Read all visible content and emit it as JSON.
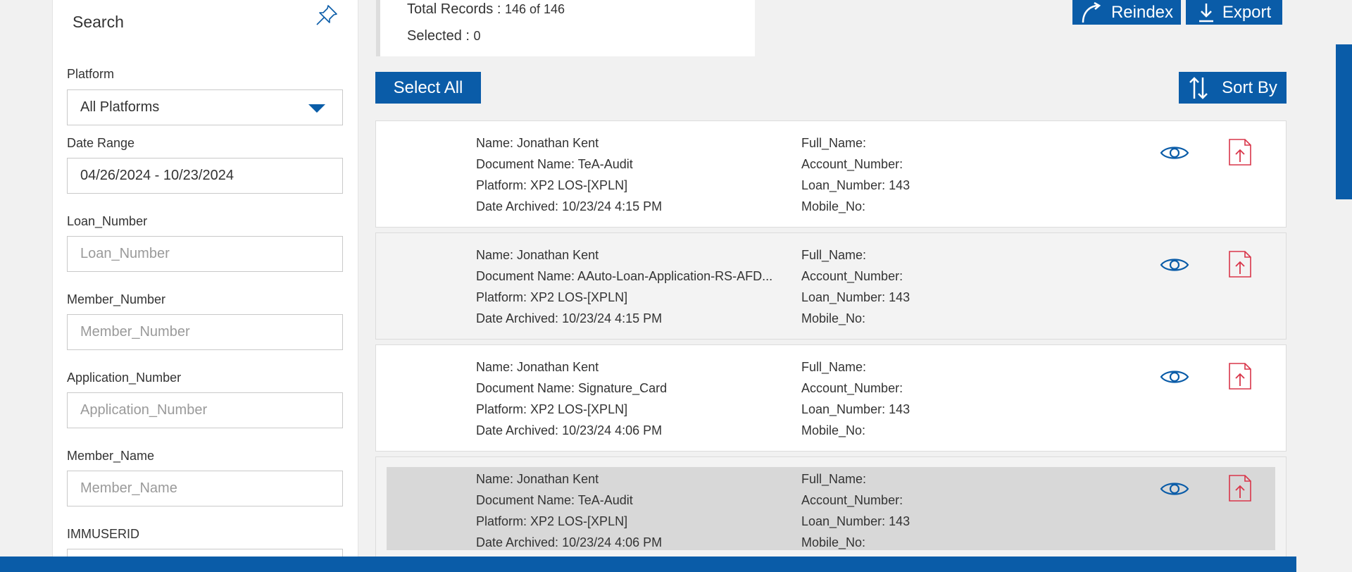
{
  "search": {
    "title": "Search",
    "fields": [
      {
        "label": "Platform",
        "value": "All Platforms",
        "type": "select"
      },
      {
        "label": "Date Range",
        "value": "04/26/2024 - 10/23/2024",
        "type": "text"
      },
      {
        "label": "Loan_Number",
        "placeholder": "Loan_Number",
        "type": "text"
      },
      {
        "label": "Member_Number",
        "placeholder": "Member_Number",
        "type": "text"
      },
      {
        "label": "Application_Number",
        "placeholder": "Application_Number",
        "type": "text"
      },
      {
        "label": "Member_Name",
        "placeholder": "Member_Name",
        "type": "text"
      },
      {
        "label": "IMMUSERID",
        "placeholder": "",
        "type": "text"
      }
    ]
  },
  "records": {
    "total_label": "Total Records :",
    "total_value": "146 of 146",
    "selected_label": "Selected :",
    "selected_value": "0"
  },
  "toolbar": {
    "reindex_label": "Reindex",
    "export_label": "Export",
    "select_all_label": "Select All",
    "sort_by_label": "Sort By"
  },
  "cards": [
    {
      "name": "Name: Jonathan Kent",
      "document": "Document Name: TeA-Audit",
      "platform": "Platform: XP2 LOS-[XPLN]",
      "archived": "Date Archived: 10/23/24 4:15 PM",
      "full_name": "Full_Name:",
      "account": "Account_Number:",
      "loan": "Loan_Number: 143",
      "mobile": "Mobile_No:"
    },
    {
      "name": "Name: Jonathan Kent",
      "document": "Document Name: AAuto-Loan-Application-RS-AFD...",
      "platform": "Platform: XP2 LOS-[XPLN]",
      "archived": "Date Archived: 10/23/24 4:15 PM",
      "full_name": "Full_Name:",
      "account": "Account_Number:",
      "loan": "Loan_Number: 143",
      "mobile": "Mobile_No:"
    },
    {
      "name": "Name: Jonathan Kent",
      "document": "Document Name: Signature_Card",
      "platform": "Platform: XP2 LOS-[XPLN]",
      "archived": "Date Archived: 10/23/24 4:06 PM",
      "full_name": "Full_Name:",
      "account": "Account_Number:",
      "loan": "Loan_Number: 143",
      "mobile": "Mobile_No:"
    },
    {
      "name": "Name: Jonathan Kent",
      "document": "Document Name: TeA-Audit",
      "platform": "Platform: XP2 LOS-[XPLN]",
      "archived": "Date Archived: 10/23/24 4:06 PM",
      "full_name": "Full_Name:",
      "account": "Account_Number:",
      "loan": "Loan_Number: 143",
      "mobile": "Mobile_No:"
    }
  ],
  "icons": {
    "view": "eye-icon",
    "pdf": "pdf-icon",
    "pin": "pin-icon"
  },
  "colors": {
    "accent": "#0a5ca8",
    "pdf_red": "#d9364a"
  }
}
